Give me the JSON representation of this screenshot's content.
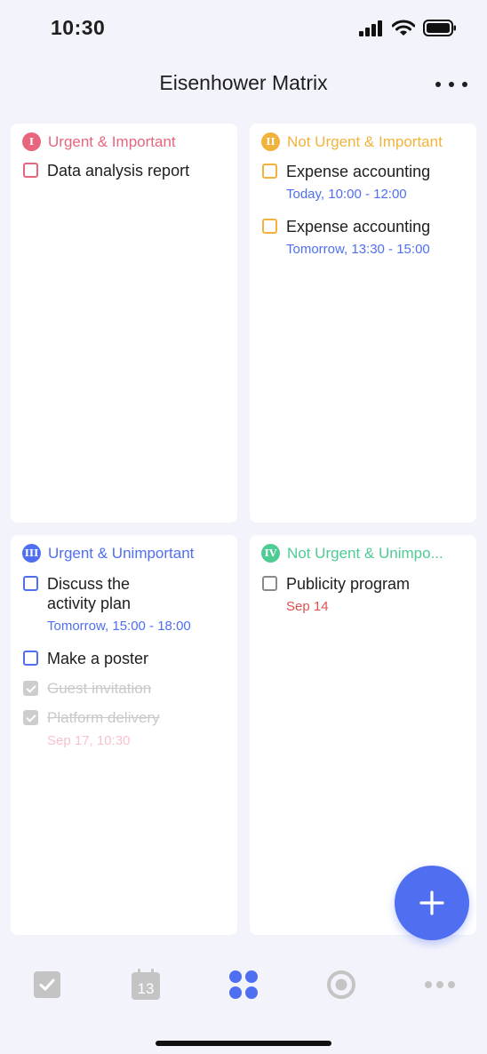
{
  "status_bar": {
    "time": "10:30"
  },
  "header": {
    "title": "Eisenhower Matrix",
    "more_icon": "ellipsis-icon"
  },
  "colors": {
    "q1": "#e8657e",
    "q2": "#f2b33d",
    "q3": "#4f6ff0",
    "q4": "#4fcb94",
    "date_blue": "#4f6ff0",
    "date_red": "#e05252",
    "date_faded": "#f5c4cd",
    "done_gray": "#c9c9c9"
  },
  "quadrants": [
    {
      "badge": "I",
      "title": "Urgent & Important",
      "tasks": [
        {
          "title": "Data analysis report"
        }
      ]
    },
    {
      "badge": "II",
      "title": "Not Urgent & Important",
      "tasks": [
        {
          "title": "Expense accounting",
          "date": "Today, 10:00 - 12:00"
        },
        {
          "title": "Expense accounting",
          "date": "Tomorrow, 13:30 - 15:00"
        }
      ]
    },
    {
      "badge": "III",
      "title": "Urgent & Unimportant",
      "tasks": [
        {
          "title_line1": "Discuss the",
          "title_line2": "activity plan",
          "date": "Tomorrow, 15:00 - 18:00"
        },
        {
          "title": "Make a poster"
        },
        {
          "title": "Guest invitation",
          "completed": true
        },
        {
          "title": "Platform delivery",
          "date": "Sep 17, 10:30",
          "completed": true
        }
      ]
    },
    {
      "badge": "IV",
      "title": "Not Urgent & Unimpo...",
      "tasks": [
        {
          "title": "Publicity program",
          "date": "Sep 14"
        }
      ]
    }
  ],
  "fab": {
    "icon": "plus-icon"
  },
  "tab_bar": {
    "tabs": [
      {
        "icon": "task-check-icon",
        "active": false
      },
      {
        "icon": "calendar-icon",
        "label": "13",
        "active": false
      },
      {
        "icon": "matrix-grid-icon",
        "active": true
      },
      {
        "icon": "focus-circle-icon",
        "active": false
      },
      {
        "icon": "more-dots-icon",
        "active": false
      }
    ]
  }
}
